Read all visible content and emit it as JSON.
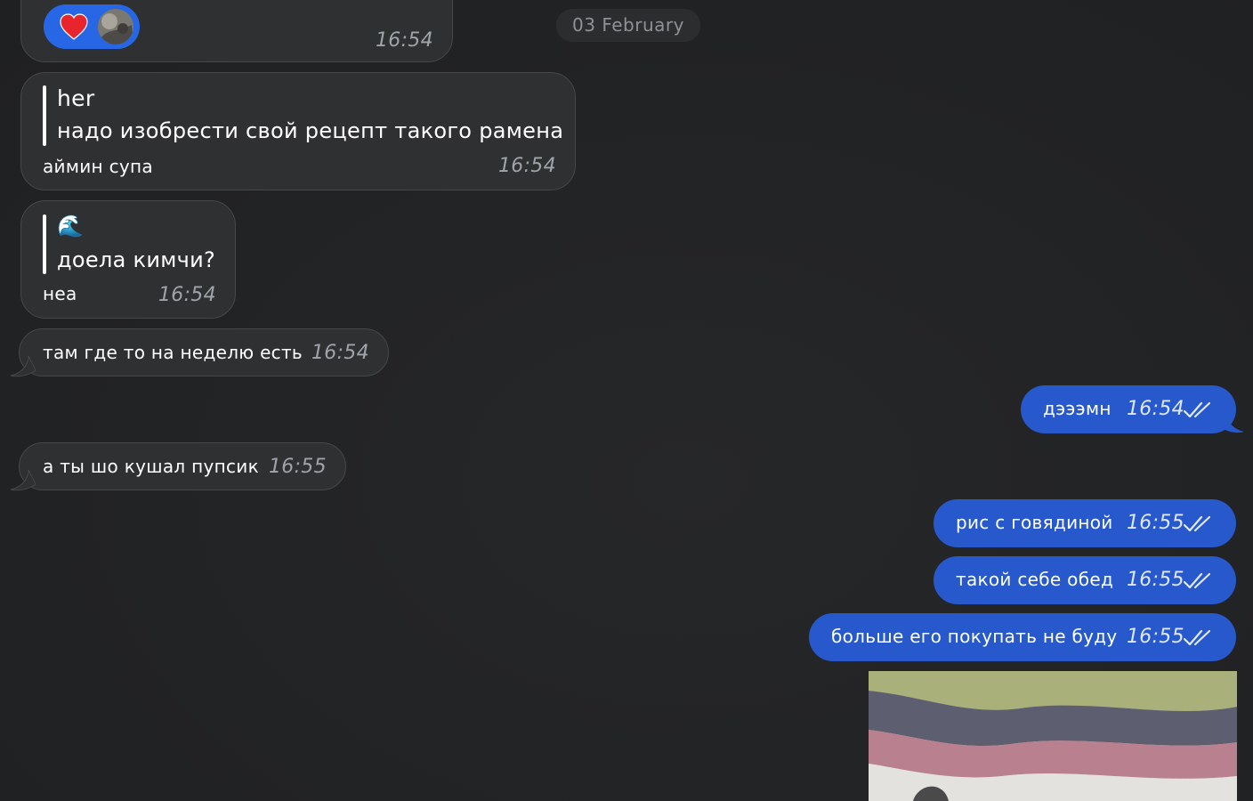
{
  "date_separator": "03 February",
  "messages": [
    {
      "kind": "incoming",
      "reaction": "heart",
      "time": "16:54"
    },
    {
      "kind": "incoming",
      "reply_author": "her",
      "reply_text": "надо изобрести свой рецепт такого рамена",
      "text": "аймин супа",
      "time": "16:54"
    },
    {
      "kind": "incoming",
      "reply_author": "🌊",
      "reply_text": "доела кимчи?",
      "text": "неа",
      "time": "16:54"
    },
    {
      "kind": "incoming",
      "text": "там где то на неделю есть",
      "time": "16:54"
    },
    {
      "kind": "outgoing",
      "text": "дэээмн",
      "time": "16:54"
    },
    {
      "kind": "incoming",
      "text": "а ты шо кушал пупсик",
      "time": "16:55"
    },
    {
      "kind": "outgoing",
      "text": "рис с говядиной",
      "time": "16:55"
    },
    {
      "kind": "outgoing",
      "text": "такой себе обед",
      "time": "16:55"
    },
    {
      "kind": "outgoing",
      "text": "больше его покупать не буду",
      "time": "16:55"
    },
    {
      "kind": "outgoing",
      "media": "photo"
    }
  ],
  "colors": {
    "outgoing_bubble": "#2759cc",
    "incoming_bubble": "#2f3032",
    "reaction_pill": "#2767e6",
    "background": "#222325"
  },
  "icons": [
    "heart-icon",
    "avatar",
    "double-check-icon"
  ]
}
